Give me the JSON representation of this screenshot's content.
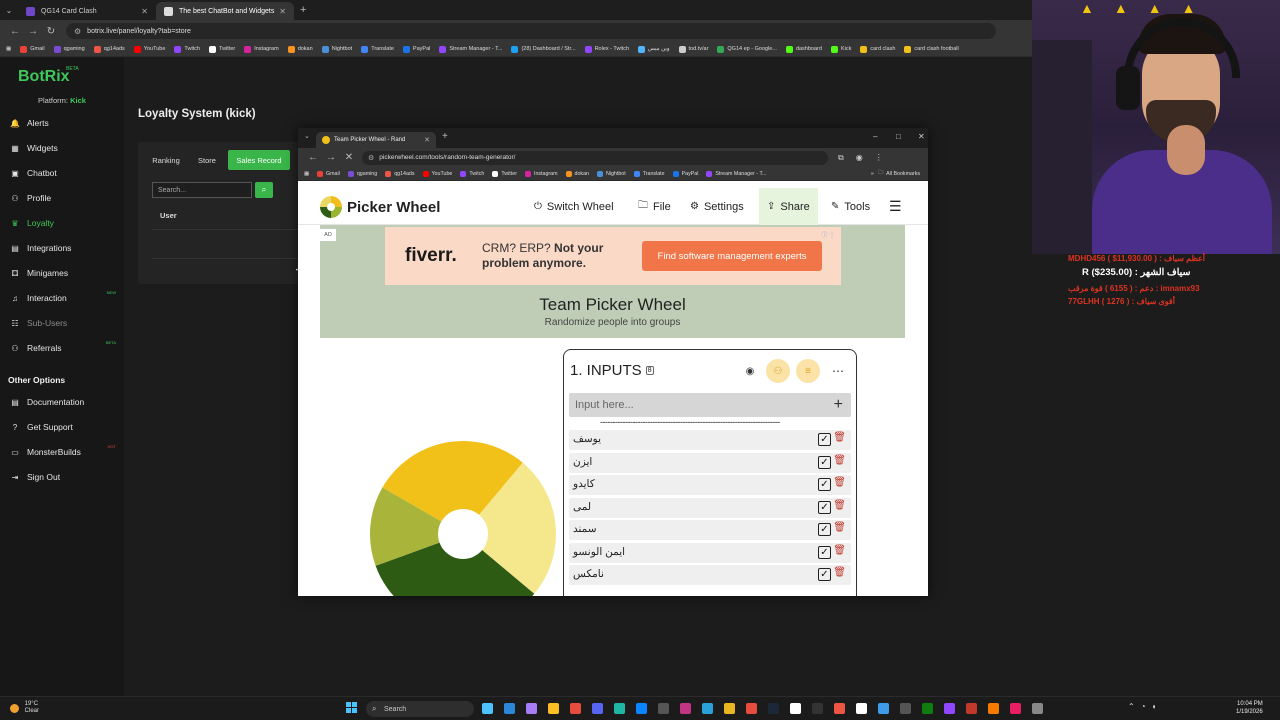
{
  "browser": {
    "tabs": [
      {
        "label": "QG14 Card Clash",
        "active": false
      },
      {
        "label": "The best ChatBot and Widgets",
        "active": true
      }
    ],
    "url": "botrix.live/panel/loyalty?tab=store",
    "bookmarks": [
      "Gmail",
      "qgaming",
      "qg14ads",
      "YouTube",
      "Twitch",
      "Twitter",
      "Instagram",
      "dokan",
      "Nightbot",
      "Translate",
      "PayPal",
      "Stream Manager - T...",
      "(28) Dashboard / Str...",
      "Rolex - Twitch",
      "وين ميس",
      "tod.tv/ar",
      "QG14 ep - Google...",
      "dashboard",
      "Kick",
      "card clash",
      "card clash football"
    ]
  },
  "botrix": {
    "logo": "BotRix",
    "beta": "BETA",
    "platform_label": "Platform:",
    "platform_value": "Kick",
    "nav": [
      {
        "label": "Alerts",
        "icon": "bell-icon"
      },
      {
        "label": "Widgets",
        "icon": "widgets-icon"
      },
      {
        "label": "Chatbot",
        "icon": "chatbot-icon"
      },
      {
        "label": "Profile",
        "icon": "profile-icon"
      },
      {
        "label": "Loyalty",
        "icon": "loyalty-icon",
        "active": true
      },
      {
        "label": "Integrations",
        "icon": "integrations-icon"
      },
      {
        "label": "Minigames",
        "icon": "minigames-icon"
      },
      {
        "label": "Interaction",
        "icon": "interaction-icon",
        "tag": "NEW"
      },
      {
        "label": "Sub-Users",
        "icon": "sub-users-icon",
        "muted": true
      },
      {
        "label": "Referrals",
        "icon": "referrals-icon",
        "tag": "BETA"
      }
    ],
    "other_header": "Other Options",
    "other": [
      {
        "label": "Documentation",
        "icon": "doc-icon"
      },
      {
        "label": "Get Support",
        "icon": "support-icon"
      },
      {
        "label": "MonsterBuilds",
        "icon": "monsterbuilds-icon",
        "tag": "HOT"
      },
      {
        "label": "Sign Out",
        "icon": "signout-icon"
      }
    ],
    "page_title": "Loyalty System (kick)",
    "card_tabs": [
      "Ranking",
      "Store",
      "Sales Record"
    ],
    "search_placeholder": "Search...",
    "table_header": "User"
  },
  "popup": {
    "tab_title": "Team Picker Wheel - Rand",
    "url": "pickerwheel.com/tools/random-team-generator/",
    "bookmarks": [
      "Gmail",
      "qgaming",
      "qg14ads",
      "YouTube",
      "Twitch",
      "Twitter",
      "Instagram",
      "dokan",
      "Nightbot",
      "Translate",
      "PayPal",
      "Stream Manager - T..."
    ],
    "all_bookmarks": "All Bookmarks",
    "brand": "Picker Wheel",
    "menu": [
      "Switch Wheel",
      "File",
      "Settings",
      "Share",
      "Tools"
    ],
    "ad_label": "AD",
    "ad_brand": "fiverr.",
    "ad_text_1": "CRM? ERP?",
    "ad_text_bold": "Not your",
    "ad_text_2": "problem anymore.",
    "ad_button": "Find software management experts",
    "title": "Team Picker Wheel",
    "subtitle": "Randomize people into groups",
    "inputs_header": "1. INPUTS",
    "inputs_count": "8",
    "input_placeholder": "Input here...",
    "dashes": "------------------------------------------------------------------------",
    "entries": [
      "يوسف",
      "ايزن",
      "كايدو",
      "لمى",
      "سمند",
      "ايمن الونسو",
      "نامكس"
    ],
    "wheel_colors": [
      "#f1c019",
      "#f5e88c",
      "#2e5b14",
      "#a9b53a"
    ]
  },
  "overlay": {
    "line1": "MDHD456 ( $11,930.00 ) : أعظم سياف",
    "line2": "R ($235.00) : سياف الشهر",
    "line3": "دعم : ( 6155 ) قوة مرقب : imnamx93",
    "line4": "77GLHH ( 1276 ) : أقوى سياف",
    "crown": "▲▲▲▲"
  },
  "taskbar": {
    "temp": "19°C",
    "weather": "Clear",
    "search": "Search",
    "time": "10:04 PM",
    "date": "1/19/2026"
  }
}
